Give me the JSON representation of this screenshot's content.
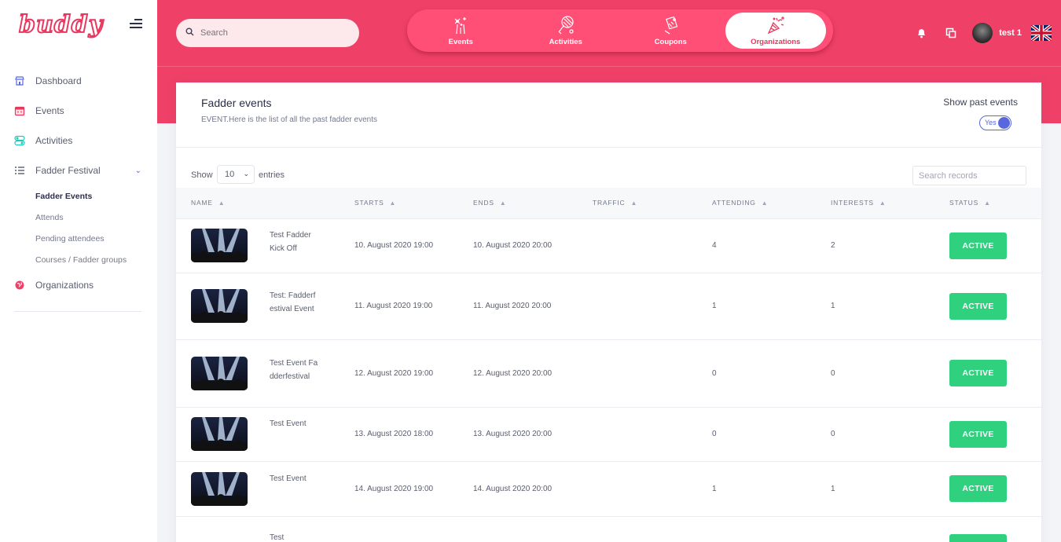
{
  "app": {
    "logo_text": "buddy"
  },
  "sidebar": {
    "items": [
      {
        "label": "Dashboard"
      },
      {
        "label": "Events"
      },
      {
        "label": "Activities"
      },
      {
        "label": "Fadder Festival"
      },
      {
        "label": "Organizations"
      }
    ],
    "subitems": [
      {
        "label": "Fadder Events"
      },
      {
        "label": "Attends"
      },
      {
        "label": "Pending attendees"
      },
      {
        "label": "Courses / Fadder groups"
      }
    ]
  },
  "header": {
    "search_placeholder": "Search",
    "tabs": [
      {
        "label": "Events"
      },
      {
        "label": "Activities"
      },
      {
        "label": "Coupons"
      },
      {
        "label": "Organizations"
      }
    ],
    "username": "test 1"
  },
  "card": {
    "title": "Fadder events",
    "subtitle": "EVENT.Here is the list of all the past fadder events",
    "past_label": "Show past events",
    "toggle_value": "Yes",
    "show_label": "Show",
    "page_length": "10",
    "entries_label": "entries",
    "search_placeholder": "Search records"
  },
  "table": {
    "columns": [
      "NAME",
      "STARTS",
      "ENDS",
      "TRAFFIC",
      "ATTENDING",
      "INTERESTS",
      "STATUS"
    ],
    "rows": [
      {
        "name": "Test Fadder Kick Off",
        "starts": "10. August 2020 19:00",
        "ends": "10. August 2020 20:00",
        "traffic": "",
        "attending": "4",
        "interests": "2",
        "status": "ACTIVE"
      },
      {
        "name": "Test: Fadderfestival Event",
        "starts": "11. August 2020 19:00",
        "ends": "11. August 2020 20:00",
        "traffic": "",
        "attending": "1",
        "interests": "1",
        "status": "ACTIVE"
      },
      {
        "name": "Test Event Fadderfestival",
        "starts": "12. August 2020 19:00",
        "ends": "12. August 2020 20:00",
        "traffic": "",
        "attending": "0",
        "interests": "0",
        "status": "ACTIVE"
      },
      {
        "name": "Test Event",
        "starts": "13. August 2020 18:00",
        "ends": "13. August 2020 20:00",
        "traffic": "",
        "attending": "0",
        "interests": "0",
        "status": "ACTIVE"
      },
      {
        "name": "Test Event",
        "starts": "14. August 2020 19:00",
        "ends": "14. August 2020 20:00",
        "traffic": "",
        "attending": "1",
        "interests": "1",
        "status": "ACTIVE"
      },
      {
        "name": "Test",
        "starts": "",
        "ends": "",
        "traffic": "",
        "attending": "",
        "interests": "",
        "status": ""
      }
    ]
  },
  "colors": {
    "brand": "#ef4068",
    "active_tab_text": "#e8385f",
    "status_active": "#2fd07e",
    "toggle": "#5867dd"
  },
  "icons": {
    "search": "search-icon",
    "bell": "bell-icon",
    "windows": "windows-icon",
    "flag": "uk-flag-icon",
    "menu": "hamburger-icon"
  }
}
